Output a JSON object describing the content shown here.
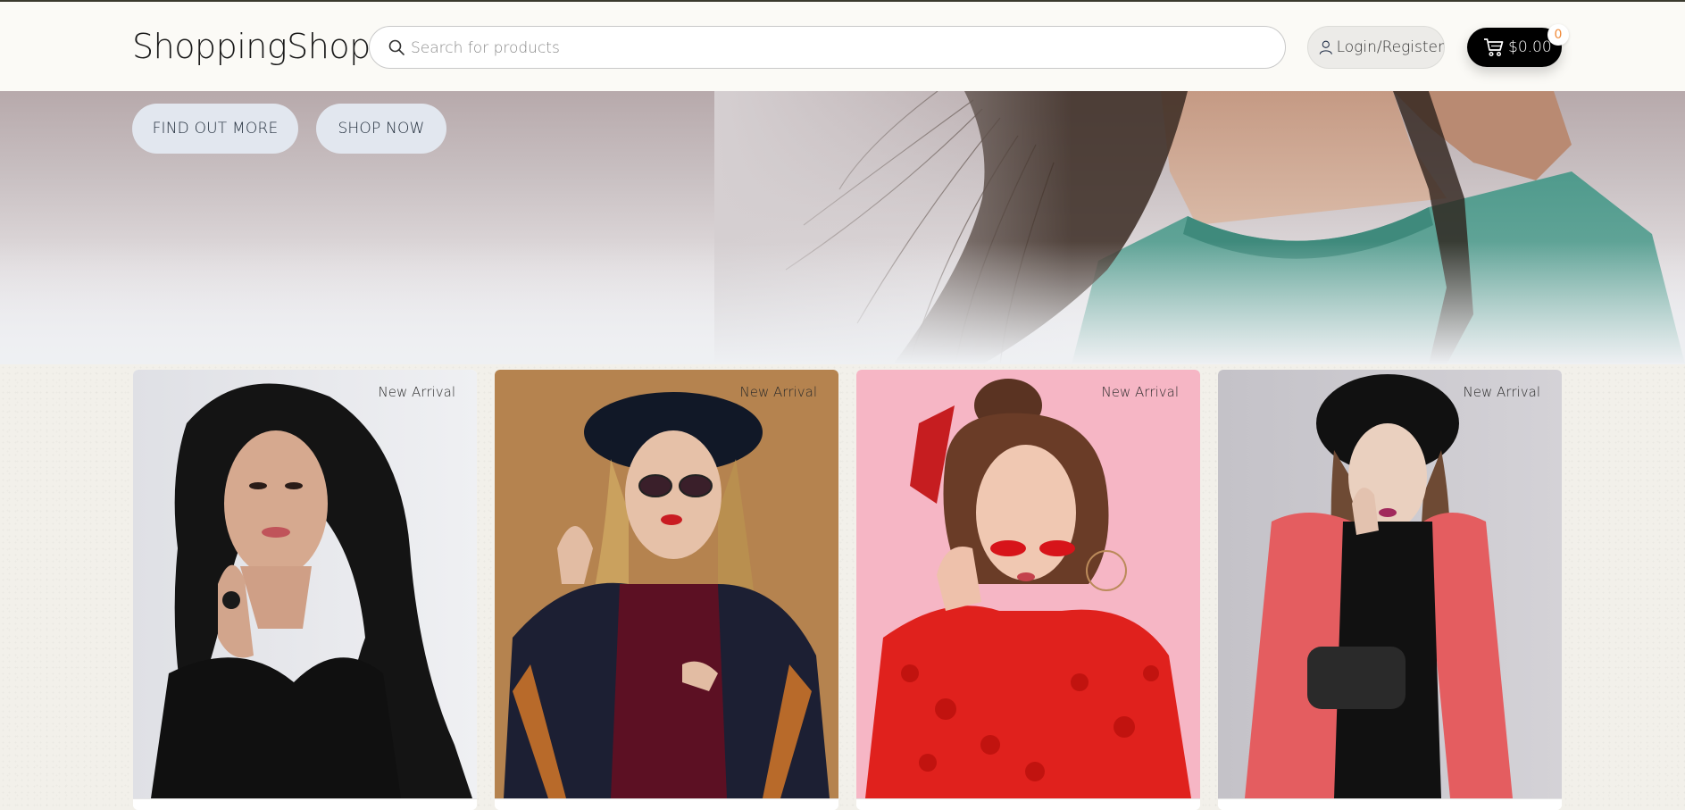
{
  "header": {
    "logo": "ShoppingShop",
    "search": {
      "placeholder": "Search for products",
      "value": ""
    },
    "login_label": "Login/Register",
    "cart": {
      "total": "$0.00",
      "count": "0"
    }
  },
  "hero": {
    "buttons": [
      "FIND OUT MORE",
      "SHOP NOW"
    ]
  },
  "products": [
    {
      "badge": "New Arrival",
      "background": "#e8e9ed"
    },
    {
      "badge": "New Arrival",
      "background": "#b4834f"
    },
    {
      "badge": "New Arrival",
      "background": "#f7b7c6"
    },
    {
      "badge": "New Arrival",
      "background": "#c9c7cc"
    }
  ],
  "icons": {
    "search": "search-icon",
    "user": "user-icon",
    "cart": "cart-icon"
  }
}
